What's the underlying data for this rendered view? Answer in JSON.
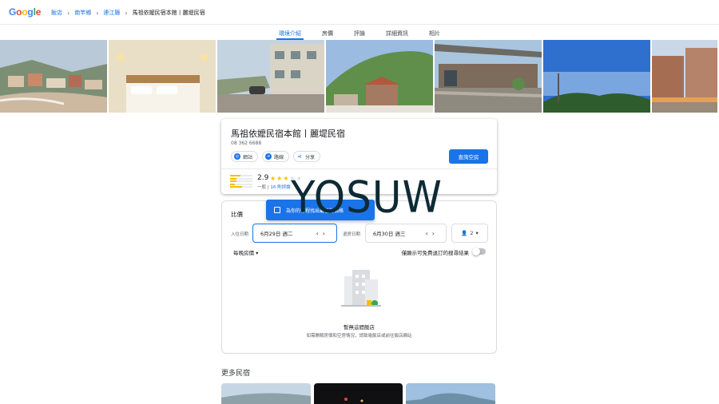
{
  "brand": {
    "logo_letters": [
      "G",
      "o",
      "o",
      "g",
      "l",
      "e"
    ]
  },
  "breadcrumb": {
    "items": [
      "飯店",
      "南竿鄉",
      "連江縣",
      "馬祖依嬤民宿本館丨麗堤民宿"
    ]
  },
  "tabs": [
    "環境介紹",
    "房價",
    "評論",
    "詳細資訊",
    "相片"
  ],
  "active_tab": "環境介紹",
  "hotel": {
    "name": "馬祖依嬤民宿本館丨麗堤民宿",
    "phone": "08 362 6688",
    "actions": [
      "網站",
      "路線",
      "分享"
    ],
    "check_button": "查詢空房",
    "rating": "2.9",
    "stars_on": 3,
    "stars_total": 5,
    "rating_label": "一般",
    "reviews_link": "16 則評論",
    "rating_bars": [
      0.45,
      0.3,
      0.3,
      0.2,
      0.55
    ]
  },
  "pricing": {
    "title": "比價",
    "banner_text": "為你的行程找出最佳的價格",
    "checkin_label": "入住日期",
    "checkin_value": "6月29日 週二",
    "checkout_label": "退房日期",
    "checkout_value": "6月30日 週三",
    "guests": "2",
    "sort_label": "每晚房價",
    "toggle_label": "僅顯示可免費退訂的搜尋結果",
    "empty_title": "暫無這間飯店",
    "empty_sub": "如需瞭解房價和空房情況，請致電飯店或前往飯店網站"
  },
  "more": {
    "title": "更多民宿"
  },
  "watermark": "YOSUW",
  "colors": {
    "accent": "#1a73e8",
    "star": "#fbbc04"
  }
}
